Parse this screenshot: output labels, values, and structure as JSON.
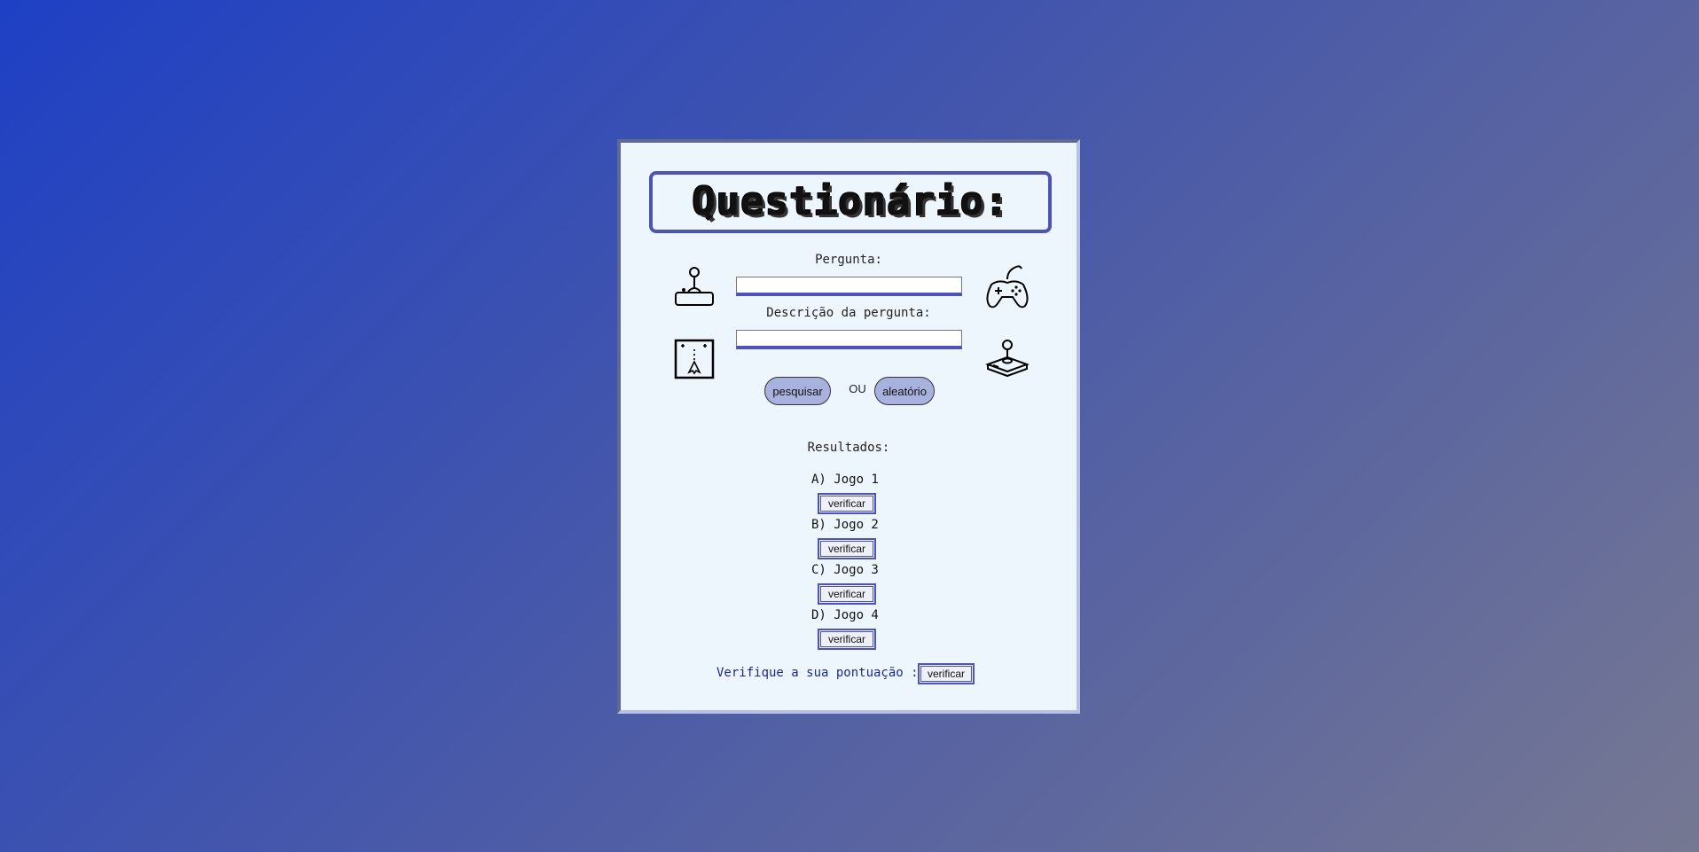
{
  "quiz": {
    "title": "Questionário:",
    "question_label": "Pergunta:",
    "question_value": "",
    "description_label": "Descrição da pergunta:",
    "description_value": "",
    "search_label": "pesquisar",
    "or_label": "OU",
    "random_label": "aleatório",
    "results_label": "Resultados:",
    "answers": [
      {
        "label": "A) Jogo 1",
        "button": "verificar"
      },
      {
        "label": "B) Jogo 2",
        "button": "verificar"
      },
      {
        "label": "C) Jogo 3",
        "button": "verificar"
      },
      {
        "label": "D) Jogo 4",
        "button": "verificar"
      }
    ],
    "score_label": "Verifique a sua pontuação :",
    "score_button": "verificar"
  },
  "icons": [
    "joystick-arcade-icon",
    "gamepad-icon",
    "space-invader-screen-icon",
    "joystick-base-icon"
  ],
  "colors": {
    "accent": "#4e54b6",
    "card_bg": "#eef6fd",
    "pill_bg": "#a9b1df",
    "score_text": "#1e2a8a"
  }
}
